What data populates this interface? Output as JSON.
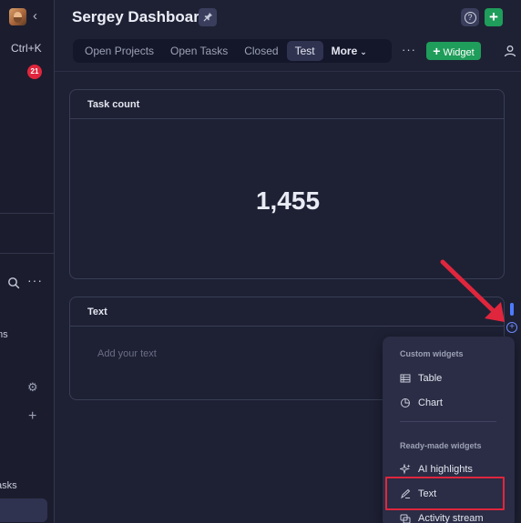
{
  "sidebar": {
    "shortcut": "Ctrl+K",
    "notification_count": "21",
    "teams_label": "ms",
    "tasks_label": "asks"
  },
  "header": {
    "title": "Sergey Dashboard",
    "pin_icon": "pin-icon",
    "help_icon": "help-icon",
    "add_icon": "plus-icon"
  },
  "tabs": [
    {
      "label": "Open Projects",
      "active": false
    },
    {
      "label": "Open Tasks",
      "active": false
    },
    {
      "label": "Closed",
      "active": false
    },
    {
      "label": "Test",
      "active": true
    }
  ],
  "more_tab": {
    "label": "More"
  },
  "toolbar": {
    "widget_label": "Widget"
  },
  "widgets": {
    "task_count": {
      "title": "Task count",
      "value": "1,455"
    },
    "text": {
      "title": "Text",
      "placeholder": "Add your text"
    }
  },
  "menu": {
    "custom_section": "Custom widgets",
    "custom_items": [
      "Table",
      "Chart"
    ],
    "ready_section": "Ready-made widgets",
    "ready_items": [
      "AI highlights",
      "Text",
      "Activity stream"
    ]
  },
  "colors": {
    "accent_green": "#1f9d5a",
    "badge_red": "#e0263d",
    "highlight_red": "#e0263d",
    "scroll_blue": "#4d7cff"
  }
}
